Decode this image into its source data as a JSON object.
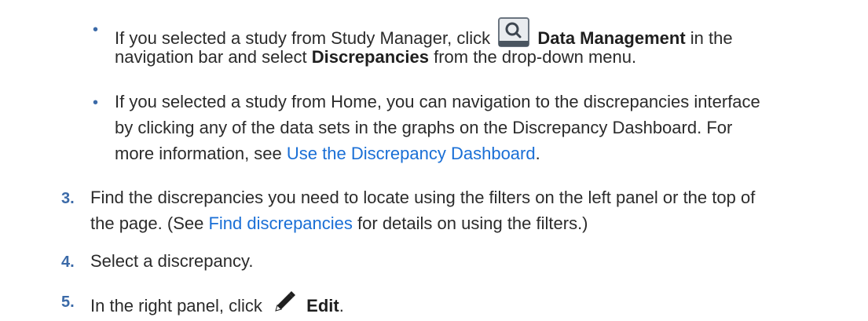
{
  "steps": {
    "bullet_1": {
      "marker": "•",
      "line1_before": "If you selected a study from Study Manager, click",
      "line1_bold": "Data Management",
      "line1_after": "in the",
      "line2_before": "navigation bar and select",
      "line2_bold": "Discrepancies",
      "line2_after": "from the drop-down menu.",
      "icon": "data-management-icon"
    },
    "bullet_2": {
      "marker": "•",
      "line1": "If you selected a study from Home, you can navigation to the discrepancies interface",
      "line2": "by clicking any of the data sets in the graphs on the Discrepancy Dashboard. For",
      "line3_before": "more information, see",
      "line3_link": "Use the Discrepancy Dashboard",
      "line3_after": "."
    },
    "step_3": {
      "number": "3.",
      "line1": "Find the discrepancies you need to locate using the filters on the left panel or the top of",
      "line2_before": "the page. (See",
      "line2_link": "Find discrepancies",
      "line2_after": "for details on using the filters.)"
    },
    "step_4": {
      "number": "4.",
      "text": "Select a discrepancy."
    },
    "step_5": {
      "number": "5.",
      "before": "In the right panel, click",
      "bold": "Edit",
      "after": ".",
      "icon": "pencil-icon"
    }
  }
}
